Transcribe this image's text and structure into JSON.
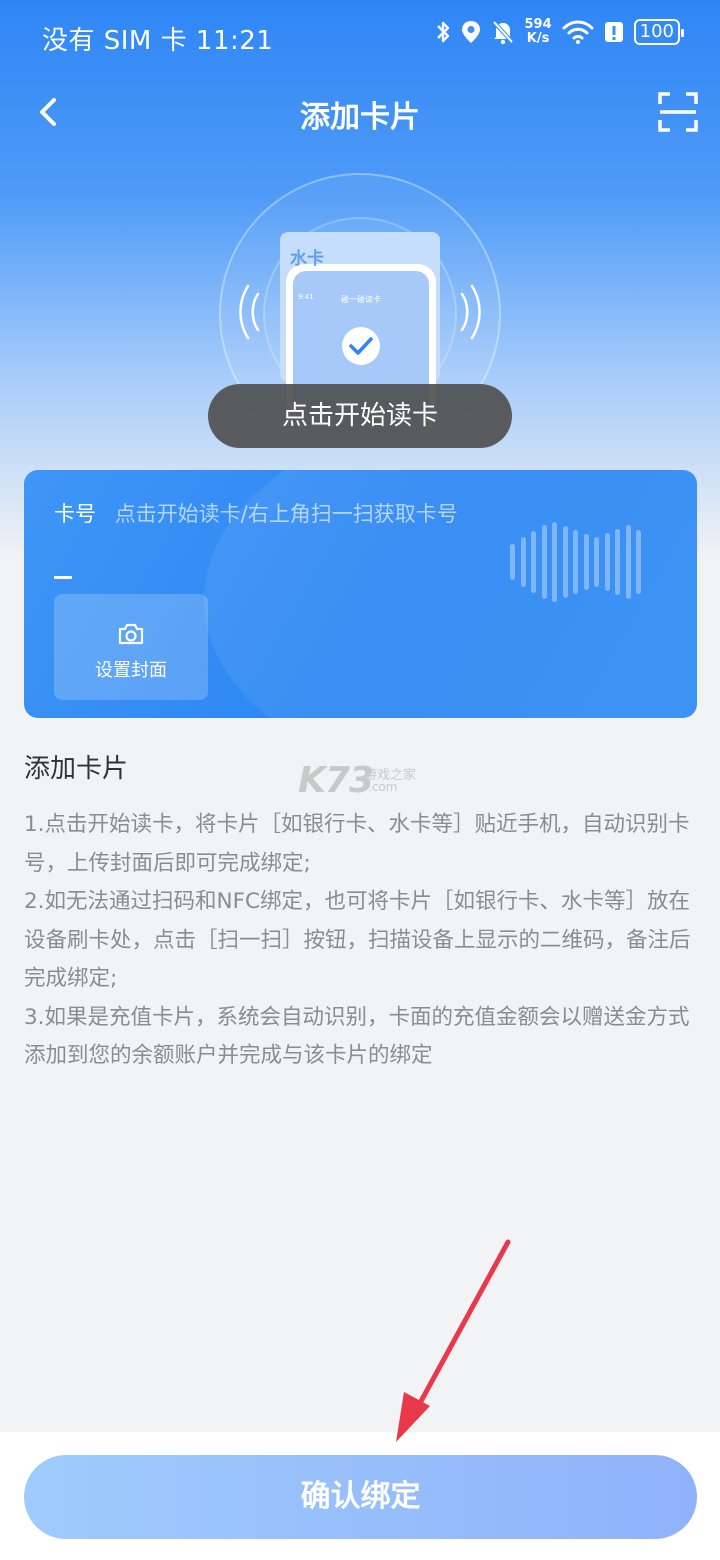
{
  "status_bar": {
    "carrier_time": "没有 SIM 卡 11:21",
    "net_speed_value": "594",
    "net_speed_unit": "K/s",
    "battery": "100",
    "icons": [
      "bluetooth-icon",
      "location-icon",
      "mute-bell-icon",
      "wifi-icon",
      "alert-icon"
    ]
  },
  "nav": {
    "title": "添加卡片",
    "back_icon": "chevron-left-icon",
    "scan_icon": "scan-icon"
  },
  "illustration": {
    "card_label": "水卡",
    "phone_title": "碰一碰读卡",
    "phone_time": "9:41",
    "check_icon": "check-circle-icon"
  },
  "toast": {
    "text": "点击开始读卡"
  },
  "card": {
    "number_label": "卡号",
    "number_hint": "点击开始读卡/右上角扫一扫获取卡号",
    "cover_label": "设置封面",
    "cover_icon": "camera-icon"
  },
  "instructions": {
    "title": "添加卡片",
    "items": [
      "1.点击开始读卡，将卡片［如银行卡、水卡等］贴近手机，自动识别卡号，上传封面后即可完成绑定;",
      "2.如无法通过扫码和NFC绑定，也可将卡片［如银行卡、水卡等］放在设备刷卡处，点击［扫一扫］按钮，扫描设备上显示的二维码，备注后完成绑定;",
      "3.如果是充值卡片，系统会自动识别，卡面的充值金额会以赠送金方式添加到您的余额账户并完成与该卡片的绑定"
    ]
  },
  "watermark": {
    "logo": "K73",
    "name": "游戏之家",
    "domain": ".com"
  },
  "footer": {
    "confirm_label": "确认绑定"
  },
  "colors": {
    "primary": "#2c86f4",
    "button_start": "#9fcbfc",
    "button_end": "#8fb2fb",
    "arrow": "#e8384a"
  }
}
